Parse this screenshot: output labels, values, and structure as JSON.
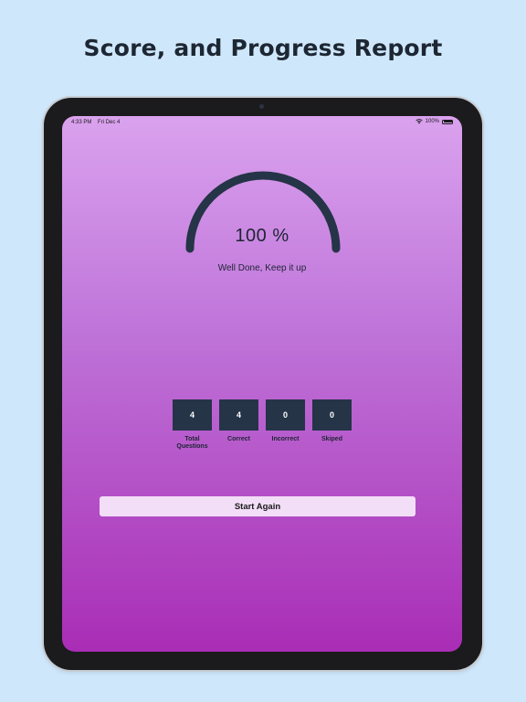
{
  "headline": "Score, and Progress Report",
  "status_bar": {
    "time": "4:33 PM",
    "date": "Fri Dec 4",
    "wifi_icon": "wifi-icon",
    "battery_text": "100%",
    "battery_icon": "battery-icon",
    "battery_level": 1.0
  },
  "score": {
    "percent_text": "100 %",
    "percent_value": 100,
    "message": "Well Done, Keep it up",
    "gauge_color": "#253447"
  },
  "stats": [
    {
      "value": "4",
      "label": "Total\nQuestions"
    },
    {
      "value": "4",
      "label": "Correct"
    },
    {
      "value": "0",
      "label": "Incorrect"
    },
    {
      "value": "0",
      "label": "Skiped"
    }
  ],
  "actions": {
    "start_again_label": "Start Again"
  },
  "colors": {
    "page_background": "#cfe7fb",
    "stat_box": "#253447",
    "button_background": "#f2def7",
    "gradient_top": "#daa2ee",
    "gradient_bottom": "#a92db5"
  }
}
